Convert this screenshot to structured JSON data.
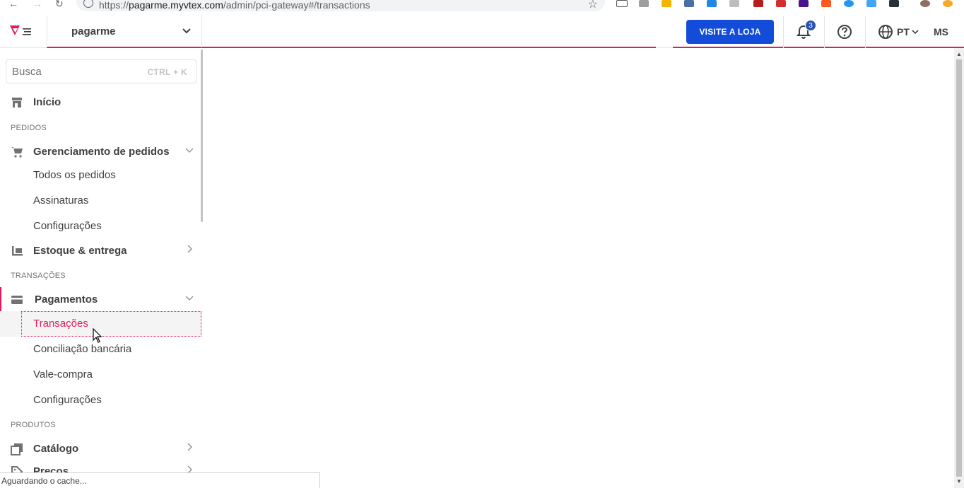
{
  "browser": {
    "url_prefix": "https://",
    "url_host": "pagarme.myvtex.com",
    "url_path": "/admin/pci-gateway#/transactions"
  },
  "header": {
    "account_name": "pagarme",
    "visit_button": "VISITE A LOJA",
    "notification_count": "3",
    "language": "PT",
    "user_initials": "MS"
  },
  "sidebar": {
    "search_placeholder": "Busca",
    "search_shortcut": "CTRL + K",
    "home": "Início",
    "sections": {
      "orders": "PEDIDOS",
      "transactions": "TRANSAÇÕES",
      "products": "PRODUTOS"
    },
    "orders_group": {
      "label": "Gerenciamento de pedidos",
      "items": [
        "Todos os pedidos",
        "Assinaturas",
        "Configurações"
      ]
    },
    "inventory": "Estoque & entrega",
    "payments_group": {
      "label": "Pagamentos",
      "items": [
        "Transações",
        "Conciliação bancária",
        "Vale-compra",
        "Configurações"
      ]
    },
    "catalog": "Catálogo",
    "prices": "Preços"
  },
  "status_bar": "Aguardando o cache...",
  "colors": {
    "accent": "#e31c58",
    "primary_button": "#134cd8",
    "badge": "#2953b2"
  }
}
